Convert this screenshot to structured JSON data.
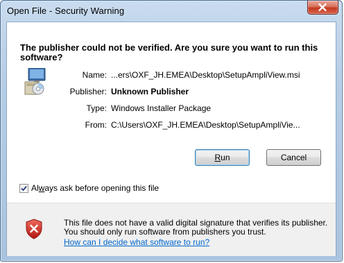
{
  "window": {
    "title": "Open File - Security Warning"
  },
  "headline": "The publisher could not be verified.  Are you sure you want to run this software?",
  "fields": {
    "name_label": "Name:",
    "name_value": "...ers\\OXF_JH.EMEA\\Desktop\\SetupAmpliView.msi",
    "publisher_label": "Publisher:",
    "publisher_value": "Unknown Publisher",
    "type_label": "Type:",
    "type_value": "Windows Installer Package",
    "from_label": "From:",
    "from_value": "C:\\Users\\OXF_JH.EMEA\\Desktop\\SetupAmpliVie..."
  },
  "buttons": {
    "run_rest": "un",
    "run_mnemonic": "R",
    "cancel_label": "Cancel"
  },
  "checkbox": {
    "checked": true,
    "label_pre": "Al",
    "label_mnemonic": "w",
    "label_post": "ays ask before opening this file"
  },
  "footer": {
    "warning_text": "This file does not have a valid digital signature that verifies its publisher.  You should only run software from publishers you trust.",
    "help_link": "How can I decide what software to run?"
  },
  "icons": {
    "installer": "windows-installer-icon",
    "shield": "security-shield-x-icon",
    "close": "close-icon"
  },
  "colors": {
    "link": "#0066cc",
    "close_button": "#c23a1f",
    "shield": "#cc2222"
  }
}
